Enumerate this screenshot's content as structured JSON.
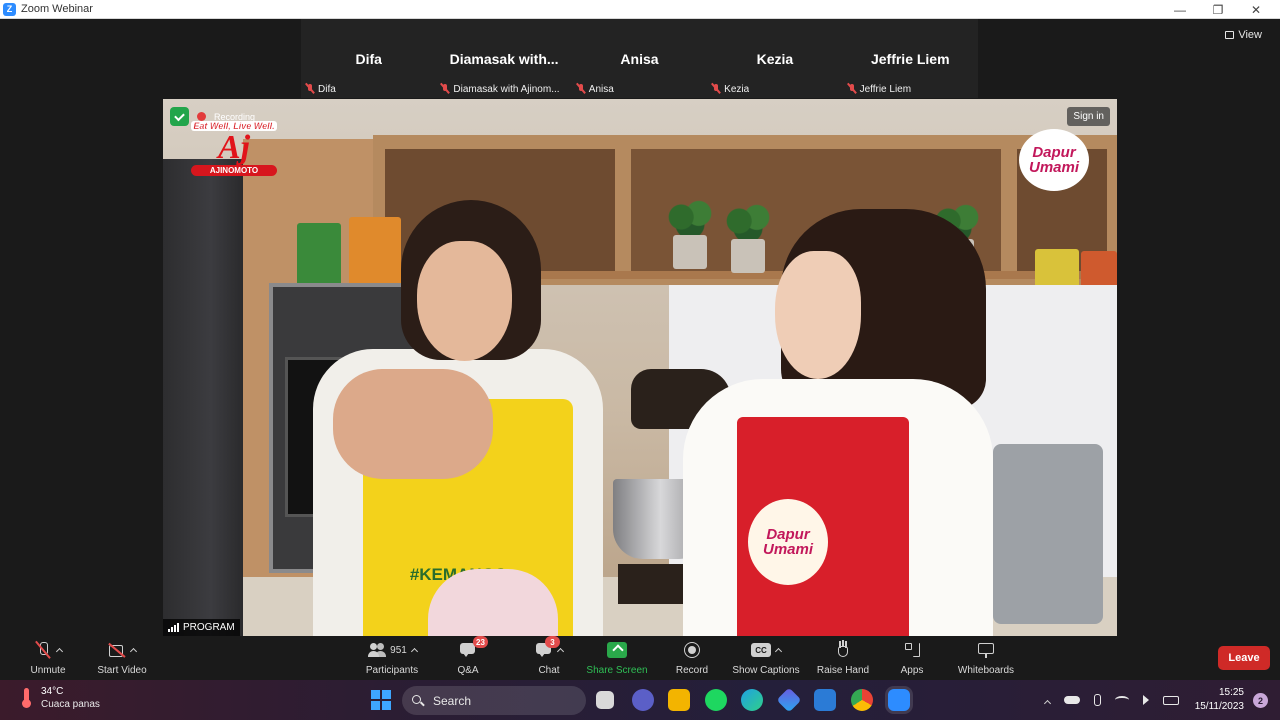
{
  "window": {
    "title": "Zoom Webinar",
    "logo_letter": "Z",
    "minimize": "—",
    "maximize": "❐",
    "close": "✕"
  },
  "view_button": {
    "label": "View"
  },
  "panelists": [
    {
      "display": "Difa",
      "name": "Difa"
    },
    {
      "display": "Diamasak with...",
      "name": "Diamasak with Ajinom..."
    },
    {
      "display": "Anisa",
      "name": "Anisa"
    },
    {
      "display": "Kezia",
      "name": "Kezia"
    },
    {
      "display": "Jeffrie Liem",
      "name": "Jeffrie Liem"
    }
  ],
  "video": {
    "recording_label": "Recording",
    "brand_tagline": "Eat Well, Live Well.",
    "brand_mark": "Aj",
    "brand_name": "AJINOMOTO",
    "dapur_line1": "Dapur",
    "dapur_line2": "Umami",
    "apron_line1": "Dapur",
    "apron_line2": "Umami",
    "apron_hashtag": "#KEMANGS",
    "sign_in": "Sign in",
    "program_label": "PROGRAM"
  },
  "toolbar": {
    "unmute": "Unmute",
    "start_video": "Start Video",
    "participants": "Participants",
    "participants_count": "951",
    "qa": "Q&A",
    "qa_badge": "23",
    "chat": "Chat",
    "chat_badge": "3",
    "share_screen": "Share Screen",
    "record": "Record",
    "show_captions": "Show Captions",
    "cc": "CC",
    "raise_hand": "Raise Hand",
    "apps": "Apps",
    "whiteboards": "Whiteboards",
    "leave": "Leave"
  },
  "taskbar": {
    "temperature": "34°C",
    "weather": "Cuaca panas",
    "search": "Search",
    "time": "15:25",
    "date": "15/11/2023",
    "notifications": "2"
  },
  "colors": {
    "accent_green": "#2aa84a",
    "leave_red": "#cf2a27",
    "mute_red": "#e24b4b",
    "zoom_blue": "#2d8cff"
  }
}
